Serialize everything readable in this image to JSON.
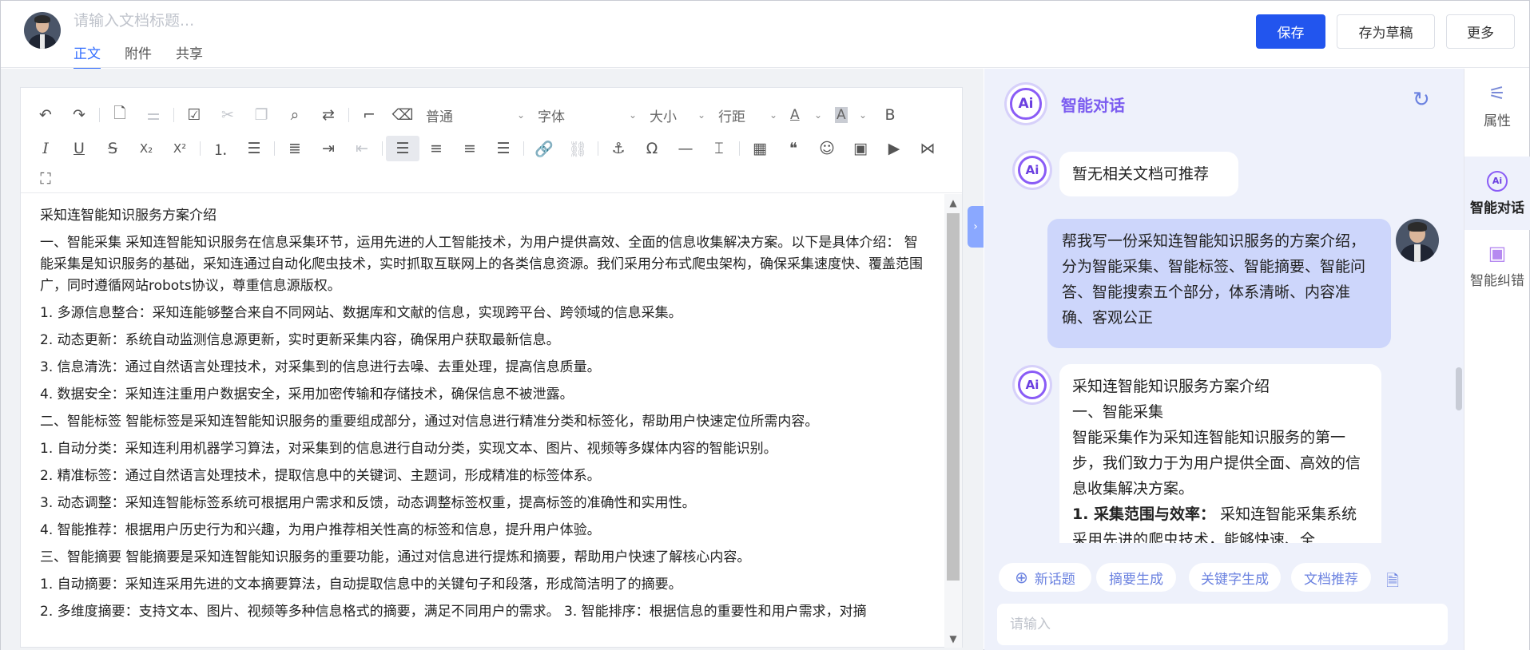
{
  "header": {
    "title_placeholder": "请输入文档标题...",
    "tabs": [
      {
        "label": "正文",
        "active": true
      },
      {
        "label": "附件",
        "active": false
      },
      {
        "label": "共享",
        "active": false
      }
    ],
    "buttons": {
      "save": "保存",
      "draft": "存为草稿",
      "more": "更多"
    }
  },
  "toolbar": {
    "dropdowns": {
      "style": "普通",
      "font": "字体",
      "size": "大小",
      "line_height": "行距"
    },
    "text_color_glyph": "A",
    "bg_color_glyph": "A",
    "bold_glyph": "B",
    "italic_glyph": "I",
    "underline_glyph": "U",
    "strike_glyph": "S",
    "sub_glyph": "X₂",
    "sup_glyph": "X²"
  },
  "document": {
    "paragraphs": [
      "采知连智能知识服务方案介绍",
      "一、智能采集 采知连智能知识服务在信息采集环节，运用先进的人工智能技术，为用户提供高效、全面的信息收集解决方案。以下是具体介绍： 智能采集是知识服务的基础，采知连通过自动化爬虫技术，实时抓取互联网上的各类信息资源。我们采用分布式爬虫架构，确保采集速度快、覆盖范围广，同时遵循网站robots协议，尊重信息源版权。",
      "1. 多源信息整合：采知连能够整合来自不同网站、数据库和文献的信息，实现跨平台、跨领域的信息采集。",
      "2. 动态更新：系统自动监测信息源更新，实时更新采集内容，确保用户获取最新信息。",
      "3. 信息清洗：通过自然语言处理技术，对采集到的信息进行去噪、去重处理，提高信息质量。",
      "4. 数据安全：采知连注重用户数据安全，采用加密传输和存储技术，确保信息不被泄露。",
      "二、智能标签 智能标签是采知连智能知识服务的重要组成部分，通过对信息进行精准分类和标签化，帮助用户快速定位所需内容。",
      "1. 自动分类：采知连利用机器学习算法，对采集到的信息进行自动分类，实现文本、图片、视频等多媒体内容的智能识别。",
      "2. 精准标签：通过自然语言处理技术，提取信息中的关键词、主题词，形成精准的标签体系。",
      "3. 动态调整：采知连智能标签系统可根据用户需求和反馈，动态调整标签权重，提高标签的准确性和实用性。",
      "4. 智能推荐：根据用户历史行为和兴趣，为用户推荐相关性高的标签和信息，提升用户体验。",
      "三、智能摘要 智能摘要是采知连智能知识服务的重要功能，通过对信息进行提炼和摘要，帮助用户快速了解核心内容。",
      "1. 自动摘要：采知连采用先进的文本摘要算法，自动提取信息中的关键句子和段落，形成简洁明了的摘要。",
      "2. 多维度摘要：支持文本、图片、视频等多种信息格式的摘要，满足不同用户的需求。 3. 智能排序：根据信息的重要性和用户需求，对摘"
    ]
  },
  "chat": {
    "title": "智能对话",
    "logo_text": "Ai",
    "messages": [
      {
        "role": "ai",
        "text": "暂无相关文档可推荐"
      },
      {
        "role": "user",
        "text": "帮我写一份采知连智能知识服务的方案介绍，分为智能采集、智能标签、智能摘要、智能问答、智能搜索五个部分，体系清晰、内容准确、客观公正"
      },
      {
        "role": "ai",
        "lines": [
          "采知连智能知识服务方案介绍",
          "一、智能采集",
          "智能采集作为采知连智能知识服务的第一步，我们致力于为用户提供全面、高效的信息收集解决方案。"
        ],
        "bold_label": "1. 采集范围与效率：",
        "tail": " 采知连智能采集系统采用先进的爬虫技术，能够快速、全"
      }
    ],
    "quick_actions": [
      "新话题",
      "摘要生成",
      "关键字生成",
      "文档推荐"
    ],
    "new_topic_icon": "⊕",
    "input_placeholder": "请输入"
  },
  "rail": {
    "items": [
      {
        "label": "属性",
        "icon": "sliders-icon",
        "active": false
      },
      {
        "label": "智能对话",
        "icon": "ai-chat-icon",
        "active": true
      },
      {
        "label": "智能纠错",
        "icon": "ai-correct-icon",
        "active": false
      }
    ]
  },
  "colors": {
    "primary": "#2255ee",
    "accent": "#2f6bff",
    "ai_purple": "#7b5cf0",
    "chat_bg": "#eef1fb",
    "user_bubble": "#cdd6fb"
  }
}
